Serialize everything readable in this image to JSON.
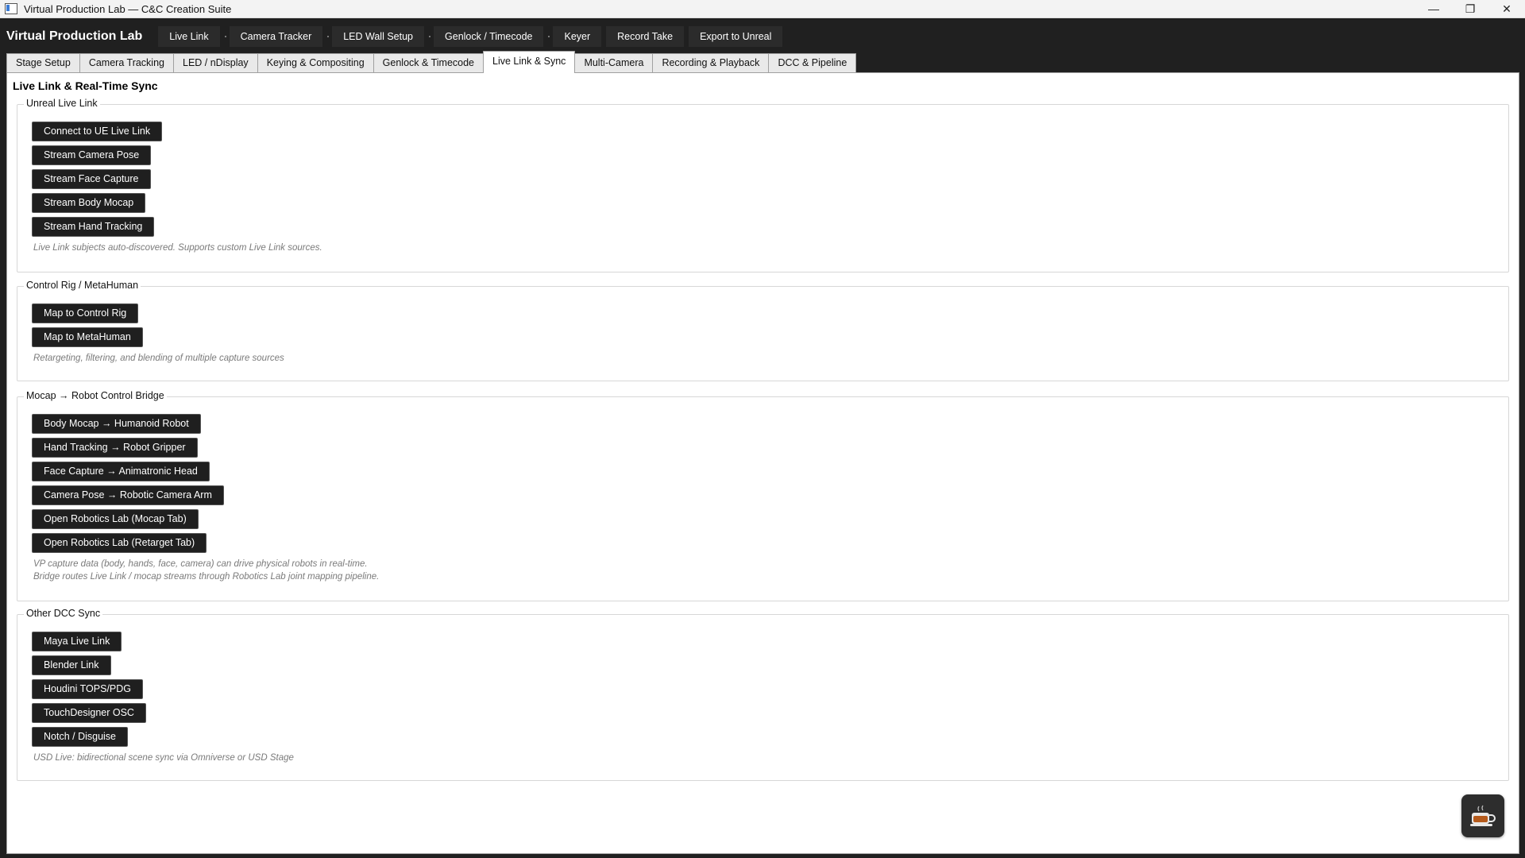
{
  "window": {
    "title": "Virtual Production Lab — C&C Creation Suite",
    "controls": {
      "minimize": "—",
      "maximize": "❐",
      "close": "✕"
    }
  },
  "toolbar": {
    "app_name": "Virtual Production Lab",
    "buttons": [
      "Live Link",
      "Camera Tracker",
      "LED Wall Setup",
      "Genlock / Timecode",
      "Keyer",
      "Record Take",
      "Export to Unreal"
    ]
  },
  "tabs": [
    "Stage Setup",
    "Camera Tracking",
    "LED / nDisplay",
    "Keying & Compositing",
    "Genlock & Timecode",
    "Live Link & Sync",
    "Multi-Camera",
    "Recording & Playback",
    "DCC & Pipeline"
  ],
  "active_tab": "Live Link & Sync",
  "page": {
    "title": "Live Link & Real-Time Sync",
    "groups": [
      {
        "title": "Unreal Live Link",
        "buttons": [
          "Connect to UE Live Link",
          "Stream Camera Pose",
          "Stream Face Capture",
          "Stream Body Mocap",
          "Stream Hand Tracking"
        ],
        "notes": [
          "Live Link subjects auto-discovered. Supports custom Live Link sources."
        ]
      },
      {
        "title": "Control Rig / MetaHuman",
        "buttons": [
          "Map to Control Rig",
          "Map to MetaHuman"
        ],
        "notes": [
          "Retargeting, filtering, and blending of multiple capture sources"
        ]
      },
      {
        "title": "Mocap → Robot Control Bridge",
        "buttons": [
          "Body Mocap → Humanoid Robot",
          "Hand Tracking → Robot Gripper",
          "Face Capture → Animatronic Head",
          "Camera Pose → Robotic Camera Arm",
          "Open Robotics Lab (Mocap Tab)",
          "Open Robotics Lab (Retarget Tab)"
        ],
        "notes": [
          "VP capture data (body, hands, face, camera) can drive physical robots in real-time.",
          "Bridge routes Live Link / mocap streams through Robotics Lab joint mapping pipeline."
        ]
      },
      {
        "title": "Other DCC Sync",
        "buttons": [
          "Maya Live Link",
          "Blender Link",
          "Houdini TOPS/PDG",
          "TouchDesigner OSC",
          "Notch / Disguise"
        ],
        "notes": [
          "USD Live: bidirectional scene sync via Omniverse or USD Stage"
        ]
      }
    ]
  },
  "colors": {
    "toolbar_bg": "#202020",
    "button_bg": "#1f1f1f",
    "note_text": "#7a7a7a"
  },
  "fab_icon": "coffee-cup-icon"
}
